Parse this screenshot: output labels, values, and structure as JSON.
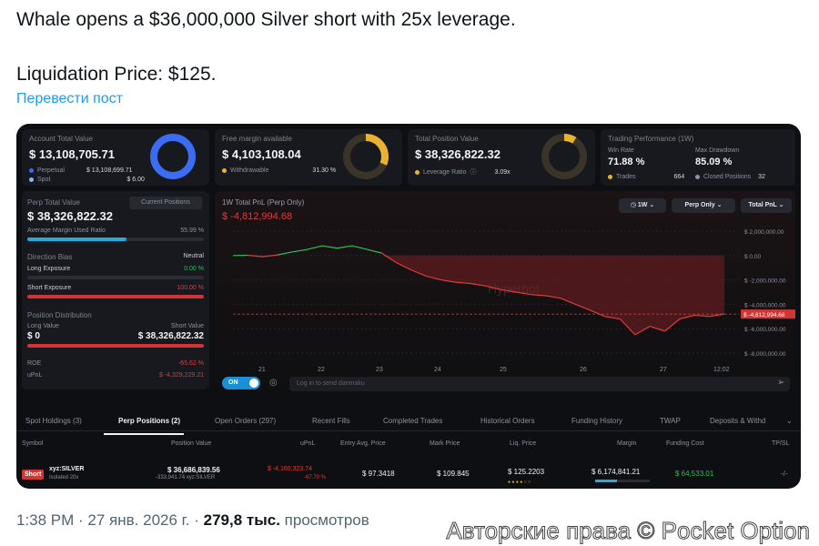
{
  "tweet": {
    "line1": "Whale opens a $36,000,000 Silver short with 25x leverage.",
    "line2": "Liquidation Price: $125.",
    "translate": "Перевести пост"
  },
  "stats": {
    "account": {
      "label": "Account Total Value",
      "value": "$ 13,108,705.71",
      "row1_label": "Perpetual",
      "row1_value": "$ 13,108,699.71",
      "row2_label": "Spot",
      "row2_value": "$ 6.00"
    },
    "margin": {
      "label": "Free margin available",
      "value": "$ 4,103,108.04",
      "row1_label": "Withdrawable",
      "row1_value": "31.30 %",
      "fill": 0.313
    },
    "position": {
      "label": "Total Position Value",
      "value": "$ 38,326,822.32",
      "row1_label": "Leverage Ratio",
      "row1_value": "3.09x",
      "fill": 0.09
    },
    "performance": {
      "label": "Trading Performance (1W)",
      "winrate_label": "Win Rate",
      "winrate": "71.88 %",
      "drawdown_label": "Max Drawdown",
      "drawdown": "85.09 %",
      "trades_label": "Trades",
      "trades": "664",
      "closed_label": "Closed Positions",
      "closed": "32"
    }
  },
  "perp": {
    "label": "Perp Total Value",
    "button": "Current Positions",
    "value": "$ 38,326,822.32",
    "margin_label": "Average Margin Used Ratio",
    "margin_value": "55.99 %",
    "margin_fill": 0.5599,
    "bias_label": "Direction Bias",
    "bias_value": "Neutral",
    "long_label": "Long Exposure",
    "long_value": "0.00 %",
    "short_label": "Short Exposure",
    "short_value": "100.00 %",
    "dist_label": "Position Distribution",
    "long_val_label": "Long Value",
    "short_val_label": "Short Value",
    "long_val": "$ 0",
    "short_val": "$ 38,326,822.32",
    "roe_label": "ROE",
    "roe_value": "-65.62 %",
    "upnl_label": "uPnL",
    "upnl_value": "$ -4,329,229.21"
  },
  "chart_ui": {
    "title": "1W Total PnL (Perp Only)",
    "value": "$ -4,812,994.68",
    "period": "1W",
    "filter": "Perp Only",
    "metric": "Total PnL",
    "toggle": "ON",
    "danmaku_placeholder": "Log in to send danmaku",
    "watermark": "Hyperbot"
  },
  "chart_data": {
    "type": "line",
    "title": "1W Total PnL (Perp Only)",
    "x": [
      "21",
      "22",
      "23",
      "24",
      "25",
      "26",
      "27",
      "12:02"
    ],
    "y_ticks": [
      "$ 2,000,000.00",
      "$ 0.00",
      "$ -2,000,000.00",
      "$ -4,000,000.00",
      "$ -6,000,000.00",
      "$ -8,000,000.00"
    ],
    "ylim": [
      -8000000,
      2000000
    ],
    "last_value_label": "$ -4,812,994.68",
    "series": [
      {
        "values": [
          0,
          20000,
          -100000,
          50000,
          300000,
          500000,
          800000,
          600000,
          800000,
          500000,
          200000,
          -600000,
          -1200000,
          -1700000,
          -2000000,
          -2200000,
          -2300000,
          -2500000,
          -2800000,
          -3000000,
          -3200000,
          -3300000,
          -3500000,
          -4000000,
          -4500000,
          -5000000,
          -5200000,
          -6500000,
          -5800000,
          -6200000,
          -5200000,
          -4900000,
          -5000000,
          -4800000
        ],
        "positive_color": "#2fbf5b",
        "negative_color": "#e03b3b"
      }
    ]
  },
  "tabs": [
    "Spot Holdings (3)",
    "Perp Positions (2)",
    "Open Orders (297)",
    "Recent Fills",
    "Completed Trades",
    "Historical Orders",
    "Funding History",
    "TWAP",
    "Deposits & Withd"
  ],
  "table": {
    "headers": [
      "Symbol",
      "Position Value",
      "uPnL",
      "Entry Avg. Price",
      "Mark Price",
      "Liq. Price",
      "Margin",
      "Funding Cost",
      "TP/SL"
    ],
    "row": {
      "side": "Short",
      "symbol": "xyz:SILVER",
      "mode": "Isolated 20x",
      "position_value": "$ 36,686,839.56",
      "position_size": "-333,941.74 xyz:SILVER",
      "upnl": "$ -4,160,323.74",
      "upnl_pct": "-67.70 %",
      "entry": "$ 97.3418",
      "mark": "$ 109.845",
      "liq": "$ 125.2203",
      "margin": "$ 6,174,841.21",
      "funding": "$ 64,533.01",
      "tpsl": "-/-"
    }
  },
  "meta": {
    "time": "1:38 PM · 27 янв. 2026 г. ·",
    "views": "279,8 тыс.",
    "views_label": "просмотров",
    "watermark": "Авторские права © Pocket Option"
  }
}
